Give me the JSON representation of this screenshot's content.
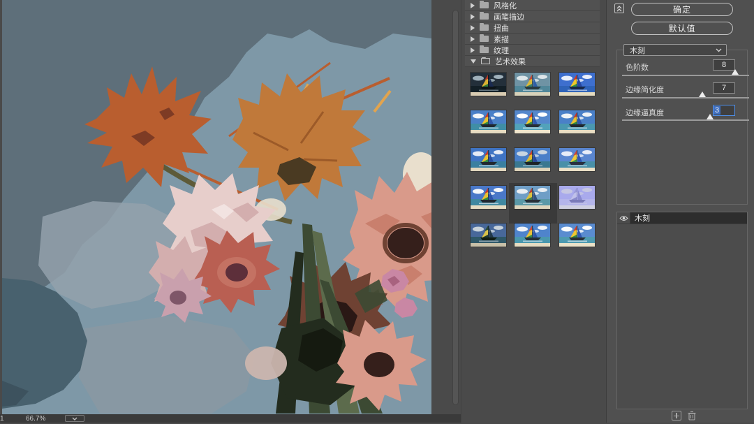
{
  "preview": {
    "zoom_level": "66.7%",
    "partial_text": "1",
    "image_description": "cutout-posterized flower bouquet on blue-gray background"
  },
  "filter_gallery": {
    "categories": [
      {
        "label": "风格化",
        "expanded": false
      },
      {
        "label": "画笔描边",
        "expanded": false
      },
      {
        "label": "扭曲",
        "expanded": false
      },
      {
        "label": "素描",
        "expanded": false
      },
      {
        "label": "纹理",
        "expanded": false
      },
      {
        "label": "艺术效果",
        "expanded": true
      }
    ],
    "thumbnails": [
      {
        "sky": "#232f3a",
        "cloud": "#9fb0ba",
        "sea": "#131f26",
        "sand": "#d9ccb2",
        "sailA": "#b03828",
        "sailB": "#d8b032",
        "sailC": "#2f7a3a",
        "sailD": "#1a2a50",
        "hull": "#0d1418",
        "selected": false
      },
      {
        "sky": "#6f93a4",
        "cloud": "#dde6ea",
        "sea": "#518799",
        "sand": "#d8d2ba",
        "sailA": "#c04838",
        "sailB": "#d8b83a",
        "sailC": "#38806a",
        "sailD": "#2f5fa8",
        "hull": "#2a3a40",
        "selected": false
      },
      {
        "sky": "#3e6fce",
        "cloud": "#e9effc",
        "sea": "#2f63b8",
        "sand": "#e6dcc0",
        "sailA": "#d03828",
        "sailB": "#f0c828",
        "sailC": "#309048",
        "sailD": "#2848a0",
        "hull": "#182848",
        "selected": false
      },
      {
        "sky": "#4a80c8",
        "cloud": "#f2f5f8",
        "sea": "#3f8ea6",
        "sand": "#e6dcc2",
        "sailA": "#c83828",
        "sailB": "#e8c030",
        "sailC": "#2f8840",
        "sailD": "#2f56a8",
        "hull": "#202830",
        "selected": false
      },
      {
        "sky": "#5588cc",
        "cloud": "#ffffff",
        "sea": "#52a2ba",
        "sand": "#efe6cd",
        "sailA": "#d04030",
        "sailB": "#f0c830",
        "sailC": "#348a44",
        "sailD": "#3058b0",
        "hull": "#283038",
        "selected": false
      },
      {
        "sky": "#4a80c8",
        "cloud": "#eef2f6",
        "sea": "#4a98b0",
        "sand": "#e8dec4",
        "sailA": "#c83828",
        "sailB": "#e8c030",
        "sailC": "#2f8840",
        "sailD": "#2f56a8",
        "hull": "#202830",
        "selected": false
      },
      {
        "sky": "#3f74c4",
        "cloud": "#e6ecf6",
        "sea": "#3a80a0",
        "sand": "#e2d8be",
        "sailA": "#c83828",
        "sailB": "#e8c030",
        "sailC": "#2f8840",
        "sailD": "#2a50a0",
        "hull": "#202830",
        "selected": false
      },
      {
        "sky": "#4a7fc8",
        "cloud": "#c9d5e1",
        "sea": "#3a7890",
        "sand": "#dcd2b8",
        "sailA": "#c04030",
        "sailB": "#e0b830",
        "sailC": "#2f7a48",
        "sailD": "#284898",
        "hull": "#1c2428",
        "selected": false
      },
      {
        "sky": "#5a86d0",
        "cloud": "#e8ecf8",
        "sea": "#4890a8",
        "sand": "#eae0c6",
        "sailA": "#d04838",
        "sailB": "#f0c838",
        "sailC": "#389048",
        "sailD": "#3058b0",
        "hull": "#283040",
        "selected": false
      },
      {
        "sky": "#4a78c8",
        "cloud": "#f6f8fb",
        "sea": "#4088a0",
        "sand": "#e6dcc2",
        "sailA": "#c83828",
        "sailB": "#e8c030",
        "sailC": "#2f8840",
        "sailD": "#2f56a8",
        "hull": "#202830",
        "selected": false
      },
      {
        "sky": "#6f9ec6",
        "cloud": "#e9eef3",
        "sea": "#5a99a8",
        "sand": "#ddd5bd",
        "sailA": "#b84030",
        "sailB": "#d8c040",
        "sailC": "#3a7a50",
        "sailD": "#32527e",
        "hull": "#283038",
        "selected": true
      },
      {
        "sky": "#a9aaec",
        "cloud": "#c6c7e2",
        "sea": "#b4b5ea",
        "sand": "#cfd0e0",
        "sailA": "#9a9bd8",
        "sailB": "#c0c1ea",
        "sailC": "#8a8bcc",
        "sailD": "#8a8bd0",
        "hull": "#7a7bb8",
        "selected": false
      },
      {
        "sky": "#48689a",
        "cloud": "#c8d2da",
        "sea": "#2f5868",
        "sand": "#c8c0a8",
        "sailA": "#284a38",
        "sailB": "#d8c048",
        "sailC": "#1f3a2c",
        "sailD": "#223848",
        "hull": "#101c14",
        "selected": false
      },
      {
        "sky": "#4f84cc",
        "cloud": "#eef2f8",
        "sea": "#4a98ae",
        "sand": "#e6dcc2",
        "sailA": "#c84838",
        "sailB": "#e8c038",
        "sailC": "#348848",
        "sailD": "#2f56a8",
        "hull": "#243038",
        "selected": false
      },
      {
        "sky": "#5a8cd0",
        "cloud": "#fafbfd",
        "sea": "#4e9ab0",
        "sand": "#ece2c8",
        "sailA": "#d04030",
        "sailB": "#f0c830",
        "sailC": "#348a44",
        "sailD": "#3058b0",
        "hull": "#283038",
        "selected": false
      }
    ]
  },
  "settings": {
    "ok_label": "确定",
    "defaults_label": "默认值",
    "filter_select": {
      "value": "木刻"
    },
    "sliders": [
      {
        "label": "色阶数",
        "value": "8",
        "percent": 89,
        "focused": false
      },
      {
        "label": "边缘简化度",
        "value": "7",
        "percent": 63,
        "focused": false
      },
      {
        "label": "边缘逼真度",
        "value": "3",
        "percent": 69,
        "focused": true
      }
    ]
  },
  "effect_layers": {
    "rows": [
      {
        "name": "木刻",
        "visible": true,
        "selected": true
      }
    ]
  },
  "colors": {
    "panel-mid": "#4a4a4a",
    "panel-right": "#505050",
    "row": "#515151",
    "row-border": "#434343",
    "text": "#e6e6e6",
    "border-light": "#c2c2c2",
    "select-bg": "#454545",
    "box-bg": "#3f3f3f",
    "sel-row": "#2d2d2d",
    "accent-focus": "#4f8fe8",
    "selection-blue": "#3f6fbf",
    "art-bg": "#7e98a7",
    "art-bg-dark": "#5e6f7a",
    "art-teal": "#48616e",
    "art-teal-dark": "#3d525e",
    "art-haze": "#93a1ab",
    "art-haze2": "#8b98a2",
    "art-orange": "#b95e2f",
    "art-orange2": "#c0793a",
    "art-orange-dark": "#7e3b24",
    "art-yellow": "#e2a44e",
    "art-olive": "#5d5a38",
    "art-center-olive": "#4a3a22",
    "art-cream": "#e9dfcd",
    "art-pink-light": "#e7cecb",
    "art-pink": "#d3aeae",
    "art-pink-hi": "#f2e3e1",
    "art-rose": "#b95f52",
    "art-rose-mid": "#c97b6b",
    "art-wine": "#5d2f3a",
    "art-mauve": "#7e5668",
    "art-mauve-light": "#c9a0ad",
    "art-salmon": "#d99a8a",
    "art-salmon2": "#c97f6d",
    "art-dark-center": "#351f1b",
    "art-dark-center2": "#2a1815",
    "art-maroon": "#6f4233",
    "art-maroon-light": "#9a5e46",
    "art-green": "#3c4a33",
    "art-green-dark": "#232c1e",
    "art-green-light": "#5c6b4c",
    "art-green-black": "#151a10",
    "art-fluff": "#cbb5ae",
    "art-carn": "#c987a4",
    "art-carn-dark": "#a8627f",
    "art-speck": "#a9bac4"
  }
}
